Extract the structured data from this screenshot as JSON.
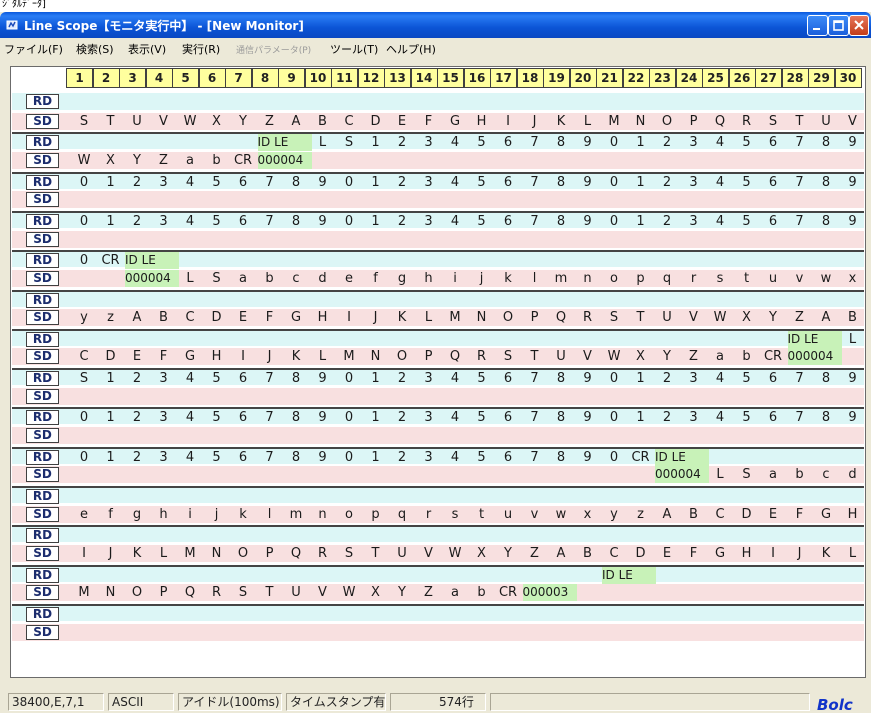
{
  "fragment": "ｼﾞﾀﾙﾃﾞｰﾀ]",
  "title": "Line Scope【モニタ実行中】 - [New Monitor]",
  "menu": [
    "ファイル(F)",
    "検索(S)",
    "表示(V)",
    "実行(R)",
    "通信パラメータ(P)",
    "ツール(T)",
    "ヘルプ(H)"
  ],
  "columns": [
    "1",
    "2",
    "3",
    "4",
    "5",
    "6",
    "7",
    "8",
    "9",
    "10",
    "11",
    "12",
    "13",
    "14",
    "15",
    "16",
    "17",
    "18",
    "19",
    "20",
    "21",
    "22",
    "23",
    "24",
    "25",
    "26",
    "27",
    "28",
    "29",
    "30"
  ],
  "rows": [
    {
      "type": "RD",
      "cells": []
    },
    {
      "type": "SD",
      "cells": [
        "S",
        "T",
        "U",
        "V",
        "W",
        "X",
        "Y",
        "Z",
        "A",
        "B",
        "C",
        "D",
        "E",
        "F",
        "G",
        "H",
        "I",
        "J",
        "K",
        "L",
        "M",
        "N",
        "O",
        "P",
        "Q",
        "R",
        "S",
        "T",
        "U",
        "V"
      ]
    },
    {
      "type": "RD",
      "cells": [
        "",
        "",
        "",
        "",
        "",
        "",
        "",
        "ID LE",
        "",
        "L",
        "S",
        "1",
        "2",
        "3",
        "4",
        "5",
        "6",
        "7",
        "8",
        "9",
        "0",
        "1",
        "2",
        "3",
        "4",
        "5",
        "6",
        "7",
        "8",
        "9"
      ]
    },
    {
      "type": "SD",
      "cells": [
        "W",
        "X",
        "Y",
        "Z",
        "a",
        "b",
        "CR",
        "000004"
      ]
    },
    {
      "type": "RD",
      "cells": [
        "0",
        "1",
        "2",
        "3",
        "4",
        "5",
        "6",
        "7",
        "8",
        "9",
        "0",
        "1",
        "2",
        "3",
        "4",
        "5",
        "6",
        "7",
        "8",
        "9",
        "0",
        "1",
        "2",
        "3",
        "4",
        "5",
        "6",
        "7",
        "8",
        "9"
      ]
    },
    {
      "type": "SD",
      "cells": []
    },
    {
      "type": "RD",
      "cells": [
        "0",
        "1",
        "2",
        "3",
        "4",
        "5",
        "6",
        "7",
        "8",
        "9",
        "0",
        "1",
        "2",
        "3",
        "4",
        "5",
        "6",
        "7",
        "8",
        "9",
        "0",
        "1",
        "2",
        "3",
        "4",
        "5",
        "6",
        "7",
        "8",
        "9"
      ]
    },
    {
      "type": "SD",
      "cells": []
    },
    {
      "type": "RD",
      "cells": [
        "0",
        "CR",
        "ID LE"
      ]
    },
    {
      "type": "SD",
      "cells": [
        "",
        "",
        "000004",
        "",
        "L",
        "S",
        "a",
        "b",
        "c",
        "d",
        "e",
        "f",
        "g",
        "h",
        "i",
        "j",
        "k",
        "l",
        "m",
        "n",
        "o",
        "p",
        "q",
        "r",
        "s",
        "t",
        "u",
        "v",
        "w",
        "x"
      ]
    },
    {
      "type": "RD",
      "cells": []
    },
    {
      "type": "SD",
      "cells": [
        "y",
        "z",
        "A",
        "B",
        "C",
        "D",
        "E",
        "F",
        "G",
        "H",
        "I",
        "J",
        "K",
        "L",
        "M",
        "N",
        "O",
        "P",
        "Q",
        "R",
        "S",
        "T",
        "U",
        "V",
        "W",
        "X",
        "Y",
        "Z",
        "A",
        "B"
      ]
    },
    {
      "type": "RD",
      "cells": [
        "",
        "",
        "",
        "",
        "",
        "",
        "",
        "",
        "",
        "",
        "",
        "",
        "",
        "",
        "",
        "",
        "",
        "",
        "",
        "",
        "",
        "",
        "",
        "",
        "",
        "",
        "",
        "ID LE",
        "",
        "L"
      ]
    },
    {
      "type": "SD",
      "cells": [
        "C",
        "D",
        "E",
        "F",
        "G",
        "H",
        "I",
        "J",
        "K",
        "L",
        "M",
        "N",
        "O",
        "P",
        "Q",
        "R",
        "S",
        "T",
        "U",
        "V",
        "W",
        "X",
        "Y",
        "Z",
        "a",
        "b",
        "CR",
        "000004"
      ]
    },
    {
      "type": "RD",
      "cells": [
        "S",
        "1",
        "2",
        "3",
        "4",
        "5",
        "6",
        "7",
        "8",
        "9",
        "0",
        "1",
        "2",
        "3",
        "4",
        "5",
        "6",
        "7",
        "8",
        "9",
        "0",
        "1",
        "2",
        "3",
        "4",
        "5",
        "6",
        "7",
        "8",
        "9"
      ]
    },
    {
      "type": "SD",
      "cells": []
    },
    {
      "type": "RD",
      "cells": [
        "0",
        "1",
        "2",
        "3",
        "4",
        "5",
        "6",
        "7",
        "8",
        "9",
        "0",
        "1",
        "2",
        "3",
        "4",
        "5",
        "6",
        "7",
        "8",
        "9",
        "0",
        "1",
        "2",
        "3",
        "4",
        "5",
        "6",
        "7",
        "8",
        "9"
      ]
    },
    {
      "type": "SD",
      "cells": []
    },
    {
      "type": "RD",
      "cells": [
        "0",
        "1",
        "2",
        "3",
        "4",
        "5",
        "6",
        "7",
        "8",
        "9",
        "0",
        "1",
        "2",
        "3",
        "4",
        "5",
        "6",
        "7",
        "8",
        "9",
        "0",
        "CR",
        "ID LE"
      ]
    },
    {
      "type": "SD",
      "cells": [
        "",
        "",
        "",
        "",
        "",
        "",
        "",
        "",
        "",
        "",
        "",
        "",
        "",
        "",
        "",
        "",
        "",
        "",
        "",
        "",
        "",
        "",
        "000004",
        "",
        "L",
        "S",
        "a",
        "b",
        "c",
        "d"
      ]
    },
    {
      "type": "RD",
      "cells": []
    },
    {
      "type": "SD",
      "cells": [
        "e",
        "f",
        "g",
        "h",
        "i",
        "j",
        "k",
        "l",
        "m",
        "n",
        "o",
        "p",
        "q",
        "r",
        "s",
        "t",
        "u",
        "v",
        "w",
        "x",
        "y",
        "z",
        "A",
        "B",
        "C",
        "D",
        "E",
        "F",
        "G",
        "H"
      ]
    },
    {
      "type": "RD",
      "cells": []
    },
    {
      "type": "SD",
      "cells": [
        "I",
        "J",
        "K",
        "L",
        "M",
        "N",
        "O",
        "P",
        "Q",
        "R",
        "S",
        "T",
        "U",
        "V",
        "W",
        "X",
        "Y",
        "Z",
        "A",
        "B",
        "C",
        "D",
        "E",
        "F",
        "G",
        "H",
        "I",
        "J",
        "K",
        "L"
      ]
    },
    {
      "type": "RD",
      "cells": [
        "",
        "",
        "",
        "",
        "",
        "",
        "",
        "",
        "",
        "",
        "",
        "",
        "",
        "",
        "",
        "",
        "",
        "",
        "",
        "",
        "ID LE"
      ]
    },
    {
      "type": "SD",
      "cells": [
        "M",
        "N",
        "O",
        "P",
        "Q",
        "R",
        "S",
        "T",
        "U",
        "V",
        "W",
        "X",
        "Y",
        "Z",
        "a",
        "b",
        "CR",
        "000003"
      ]
    },
    {
      "type": "RD",
      "cells": []
    },
    {
      "type": "SD",
      "cells": []
    }
  ],
  "status": [
    "38400,E,7,1",
    "ASCII",
    "アイドル(100ms)",
    "タイムスタンプ有",
    "574行",
    ""
  ],
  "brand": "Bolc"
}
